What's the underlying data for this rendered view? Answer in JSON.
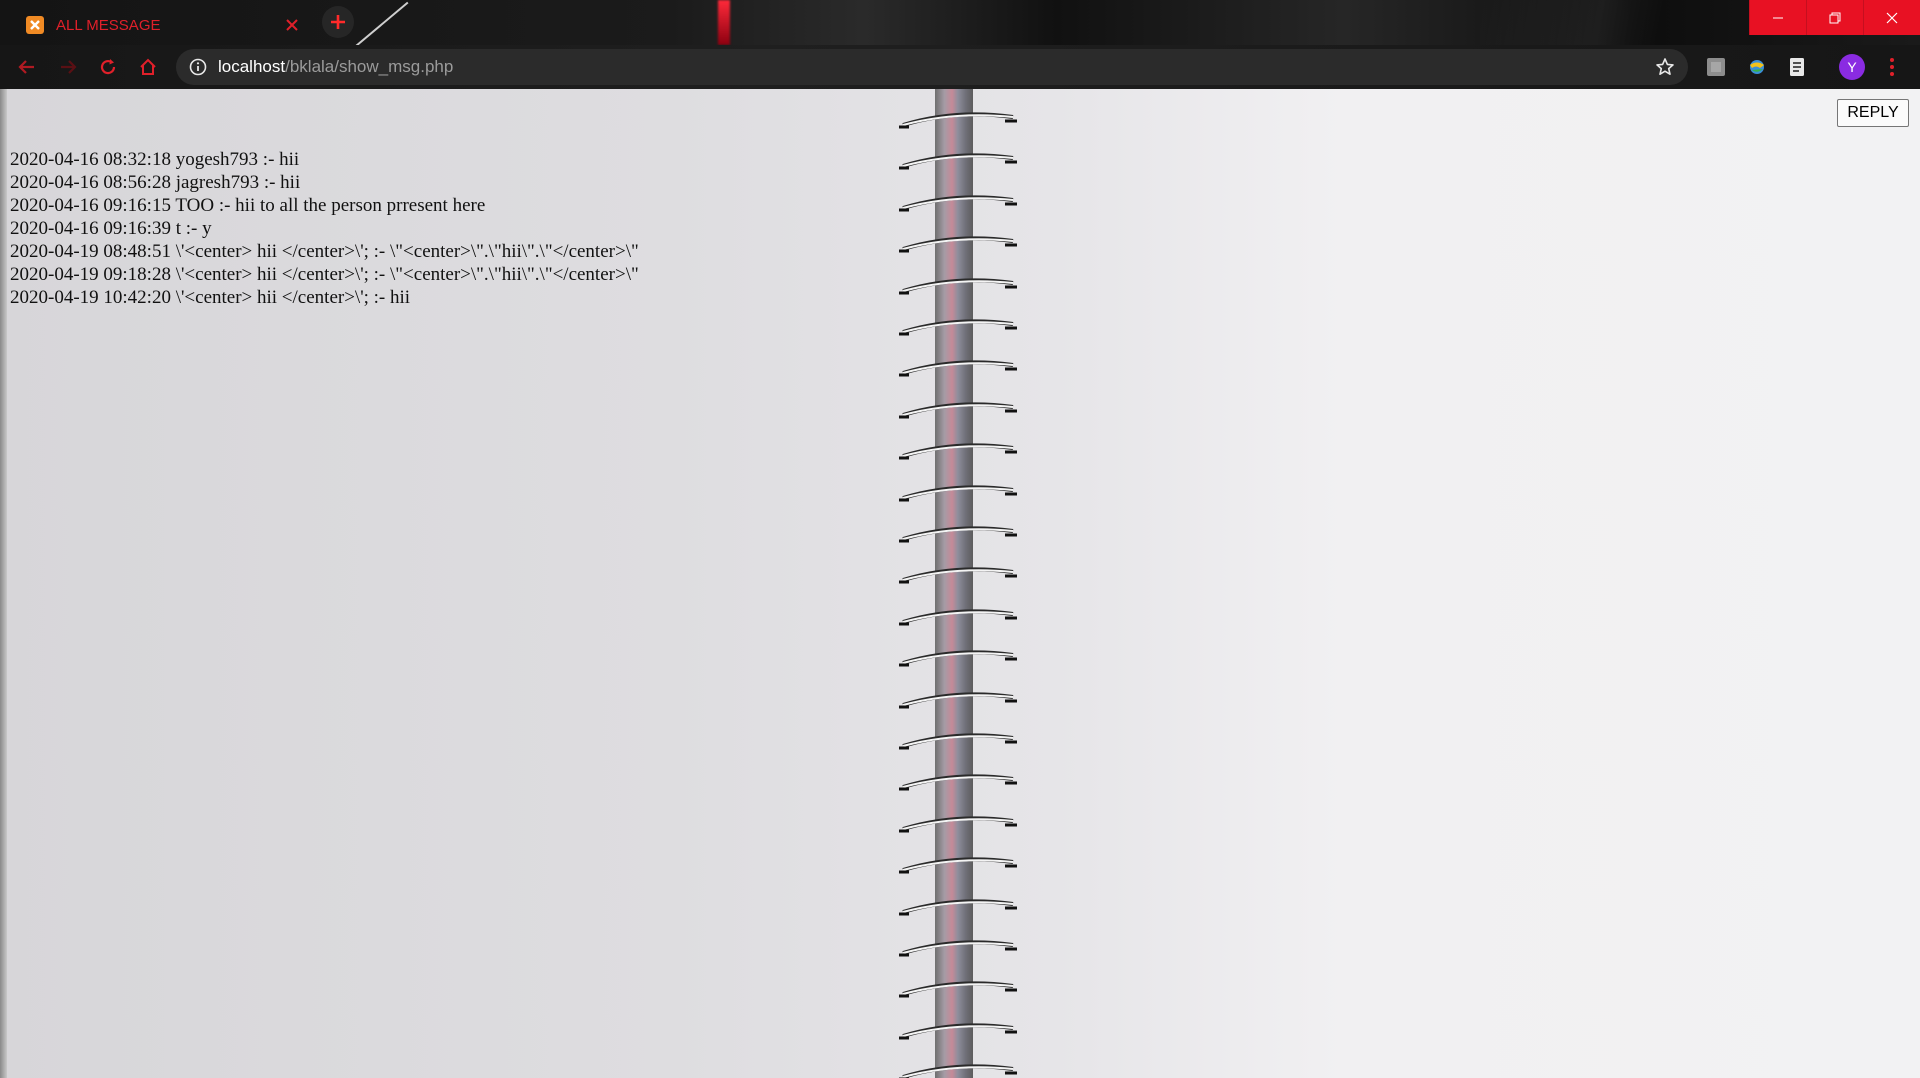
{
  "browser": {
    "tab": {
      "title": "ALL MESSAGE"
    },
    "address": {
      "host": "localhost",
      "path": "/bklala/show_msg.php"
    },
    "profile_initial": "Y"
  },
  "page": {
    "reply_label": "REPLY",
    "messages": [
      "2020-04-16 08:32:18 yogesh793 :- hii",
      "2020-04-16 08:56:28 jagresh793 :- hii",
      "2020-04-16 09:16:15 TOO :- hii to all the person prresent here",
      "2020-04-16 09:16:39 t :- y",
      "2020-04-19 08:48:51 \\'<center> hii </center>\\'; :- \\\"<center>\\\".\\\"hii\\\".\\\"</center>\\\"",
      "2020-04-19 09:18:28 \\'<center> hii </center>\\'; :- \\\"<center>\\\".\\\"hii\\\".\\\"</center>\\\"",
      "2020-04-19 10:42:20 \\'<center> hii </center>\\'; :- hii"
    ]
  },
  "colors": {
    "accent": "#e0202a",
    "window_controls": "#e81123"
  },
  "icons": {
    "tab_favicon": "xampp-icon",
    "back": "back-arrow-icon",
    "forward": "forward-arrow-icon",
    "reload": "reload-icon",
    "home": "home-icon",
    "info": "info-icon",
    "bookmark": "star-icon",
    "menu": "more-vert-icon"
  }
}
